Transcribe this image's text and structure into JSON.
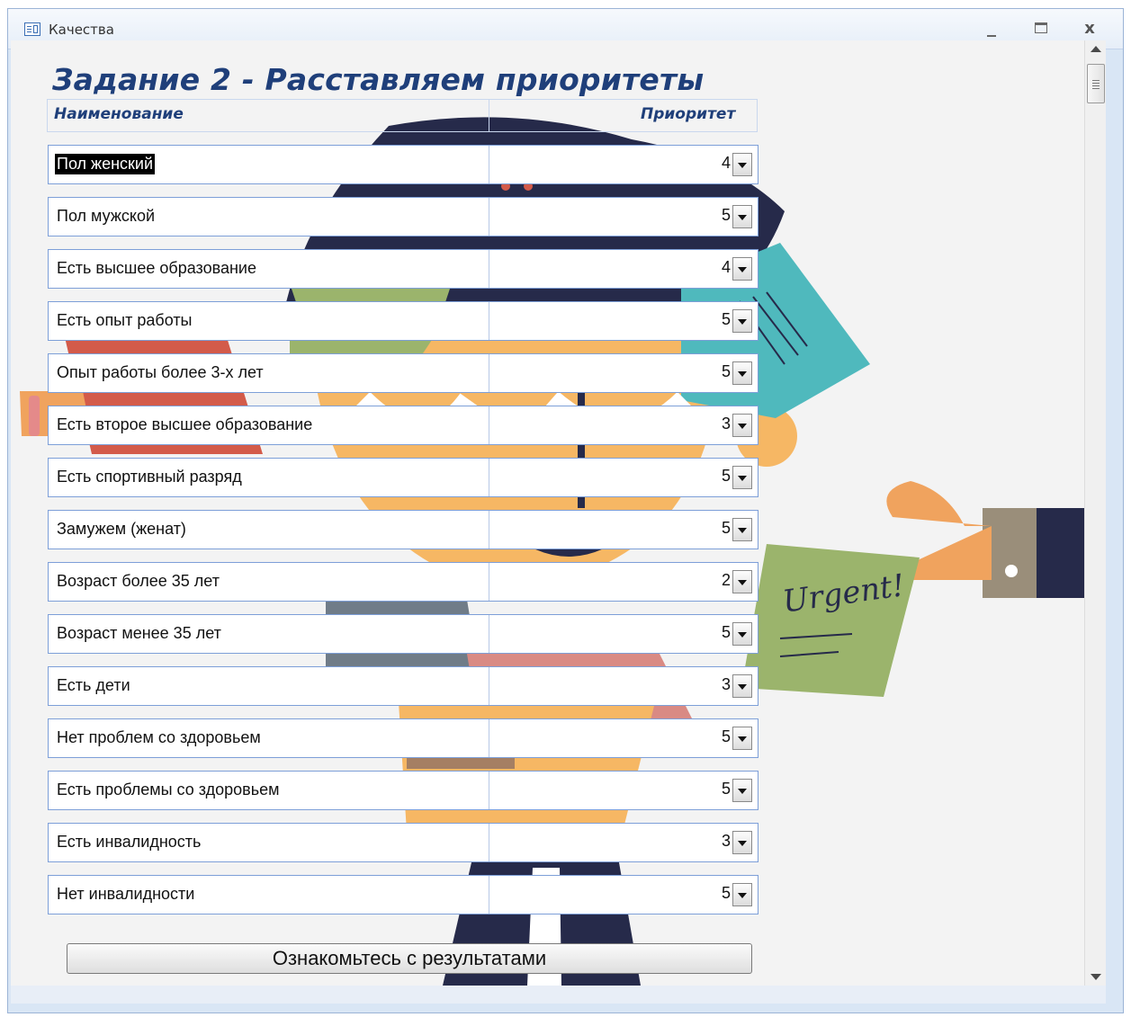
{
  "window": {
    "title": "Качества",
    "buttons": {
      "minimize": "_",
      "maximize": "□",
      "close": "x"
    }
  },
  "form": {
    "title": "Задание 2 - Расставляем приоритеты",
    "columns": {
      "name": "Наименование",
      "priority": "Приоритет"
    },
    "rows": [
      {
        "name": "Пол женский",
        "priority": "4",
        "selected": true
      },
      {
        "name": "Пол мужской",
        "priority": "5"
      },
      {
        "name": "Есть высшее образование",
        "priority": "4"
      },
      {
        "name": "Есть опыт работы",
        "priority": "5"
      },
      {
        "name": "Опыт работы более 3-х лет",
        "priority": "5"
      },
      {
        "name": "Есть второе высшее образование",
        "priority": "3"
      },
      {
        "name": "Есть спортивный разряд",
        "priority": "5"
      },
      {
        "name": "Замужем (женат)",
        "priority": "5"
      },
      {
        "name": "Возраст более 35 лет",
        "priority": "2"
      },
      {
        "name": "Возраст менее 35 лет",
        "priority": "5"
      },
      {
        "name": "Есть дети",
        "priority": "3"
      },
      {
        "name": "Нет проблем со здоровьем",
        "priority": "5"
      },
      {
        "name": "Есть проблемы со здоровьем",
        "priority": "5"
      },
      {
        "name": "Есть инвалидность",
        "priority": "3"
      },
      {
        "name": "Нет инвалидности",
        "priority": "5"
      }
    ],
    "results_button": "Ознакомьтесь с результатами"
  },
  "illustration": {
    "sticky_note_text": "Urgent!",
    "colors": {
      "skin": "#f0a35e",
      "teal_note": "#4fb9bd",
      "green_note": "#9bb46c",
      "navy": "#262a4a",
      "red": "#d35b4a"
    }
  }
}
